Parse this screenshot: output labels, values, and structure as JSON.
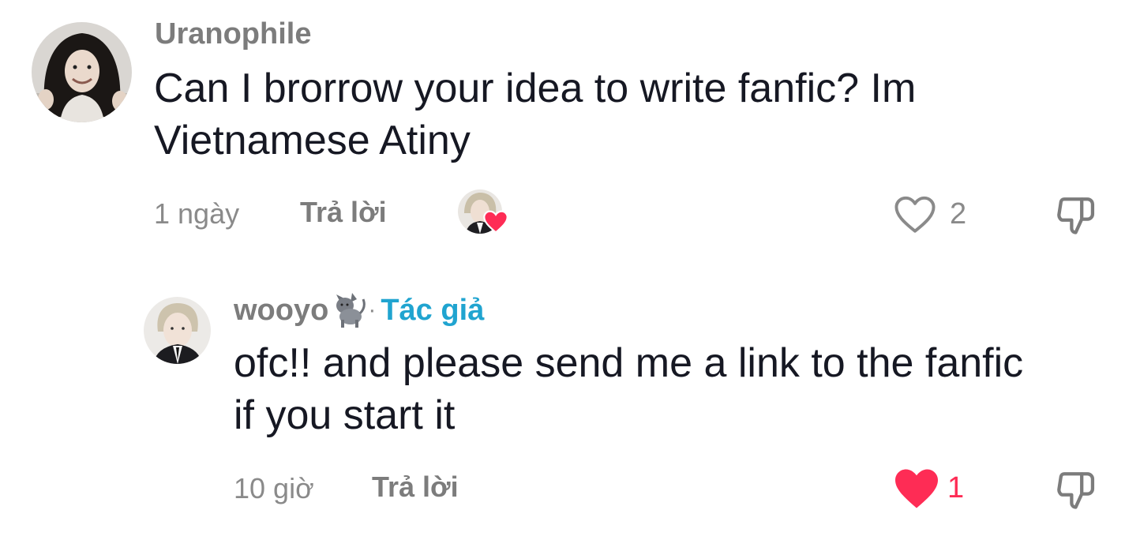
{
  "comments": [
    {
      "username": "Uranophile",
      "text": "Can I brorrow your idea to write fanfic? Im Vietnamese Atiny",
      "time": "1 ngày",
      "reply_label": "Trả lời",
      "like_count": "2",
      "liked_by_creator": true,
      "liked": false
    },
    {
      "username": "wooyo",
      "separator": "·",
      "author_badge": "Tác giả",
      "text": "ofc!! and please send me a link to the fanfic if you start it",
      "time": "10 giờ",
      "reply_label": "Trả lời",
      "like_count": "1",
      "liked": true
    }
  ],
  "colors": {
    "text": "#161823",
    "muted": "#8a8a8a",
    "author_badge": "#20a4d0",
    "like_active": "#fe2c55"
  },
  "icons": {
    "like": "heart-outline-icon",
    "liked": "heart-filled-icon",
    "dislike": "thumbs-down-icon",
    "emoji": "cat-emoji-icon"
  }
}
